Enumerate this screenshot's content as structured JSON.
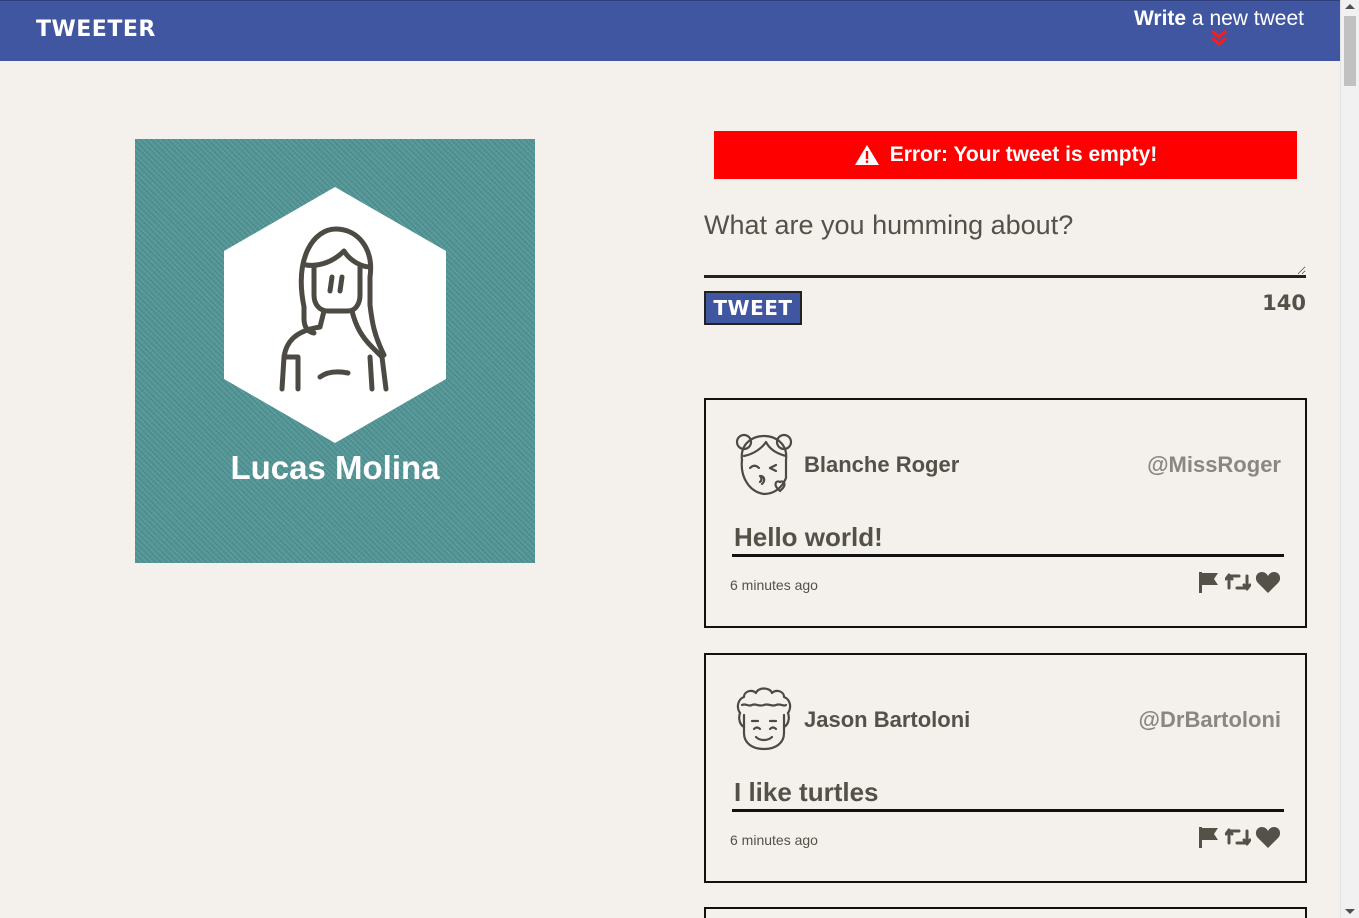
{
  "nav": {
    "brand": "TWEETER",
    "write_strong": "Write",
    "write_rest": " a new tweet",
    "chevron_icon": "double-chevron-down-icon"
  },
  "profile": {
    "name": "Lucas Molina",
    "avatar_icon": "girl-avatar-icon",
    "background_color": "#4f9495"
  },
  "error": {
    "icon": "warning-triangle-icon",
    "message": "Error: Your tweet is empty!",
    "color": "#ff0000"
  },
  "compose": {
    "placeholder": "What are you humming about?",
    "value": "",
    "button_label": "TWEET",
    "counter": "140"
  },
  "tweets": [
    {
      "name": "Blanche Roger",
      "handle": "@MissRoger",
      "content": "Hello world!",
      "time": "6 minutes ago",
      "avatar_icon": "girl-kiss-avatar-icon"
    },
    {
      "name": "Jason Bartoloni",
      "handle": "@DrBartoloni",
      "content": "I like turtles",
      "time": "6 minutes ago",
      "avatar_icon": "curly-hair-boy-avatar-icon"
    }
  ],
  "actions": {
    "flag_icon": "flag-icon",
    "retweet_icon": "retweet-icon",
    "like_icon": "heart-icon"
  },
  "colors": {
    "nav": "#4056a1",
    "background": "#f4f1ec",
    "text": "#545149"
  }
}
